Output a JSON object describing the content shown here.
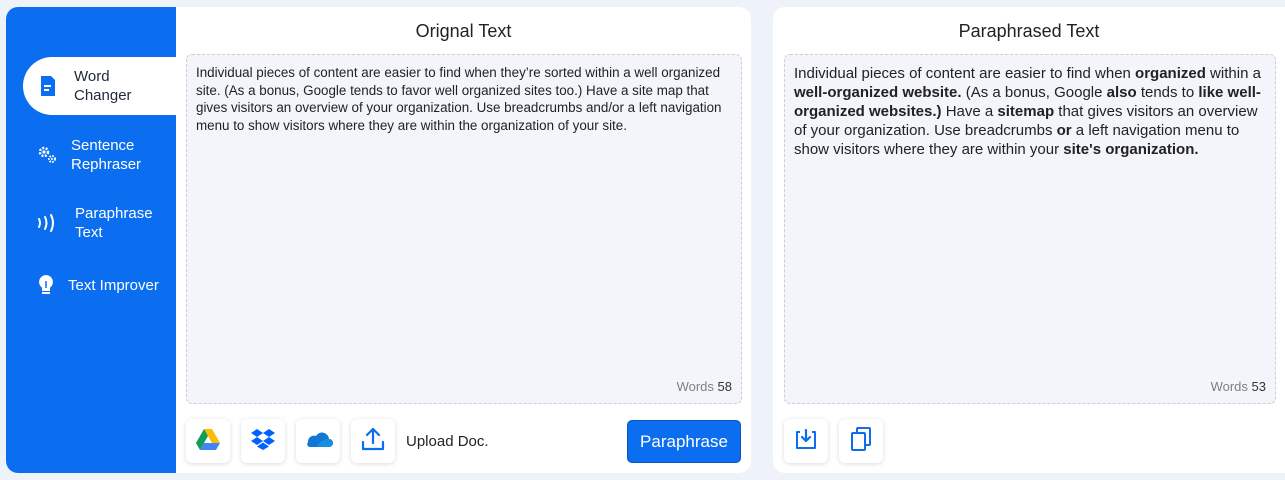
{
  "sidebar": {
    "items": [
      {
        "label": "Word\nChanger",
        "icon": "document-icon",
        "active": true
      },
      {
        "label": "Sentence\nRephraser",
        "icon": "gears-icon"
      },
      {
        "label": "Paraphrase\nText",
        "icon": "waves-icon"
      },
      {
        "label": "Text Improver",
        "icon": "lightbulb-icon"
      }
    ]
  },
  "original": {
    "title": "Orignal Text",
    "text": "Individual pieces of content are easier to find when they’re sorted within a well organized site. (As a bonus, Google tends to favor well organized sites too.) Have a site map that gives visitors an overview of your organization. Use breadcrumbs and/or a left navigation menu to show visitors where they are within the organization of your site.",
    "words_label": "Words",
    "words_count": "58"
  },
  "toolbar": {
    "buttons": [
      "google-drive-icon",
      "dropbox-icon",
      "onedrive-icon",
      "upload-icon"
    ],
    "upload_label": "Upload Doc.",
    "paraphrase_label": "Paraphrase"
  },
  "paraphrased": {
    "title": "Paraphrased Text",
    "segments": [
      {
        "t": "Individual pieces of content are easier to find when ",
        "b": false
      },
      {
        "t": "organized",
        "b": true
      },
      {
        "t": " within a ",
        "b": false
      },
      {
        "t": "well-organized website.",
        "b": true
      },
      {
        "t": " (As a bonus, Google ",
        "b": false
      },
      {
        "t": "also",
        "b": true
      },
      {
        "t": " tends to ",
        "b": false
      },
      {
        "t": "like well-organized websites.)",
        "b": true
      },
      {
        "t": " Have a ",
        "b": false
      },
      {
        "t": "sitemap",
        "b": true
      },
      {
        "t": " that gives visitors an overview of your organization. Use breadcrumbs ",
        "b": false
      },
      {
        "t": "or",
        "b": true
      },
      {
        "t": " a left navigation menu to show visitors where they are within your ",
        "b": false
      },
      {
        "t": "site's organization.",
        "b": true
      }
    ],
    "words_label": "Words",
    "words_count": "53",
    "actions": [
      "download-icon",
      "copy-icon"
    ]
  },
  "colors": {
    "accent": "#0b6ef0",
    "background": "#eef3fa",
    "textbox": "#f3f5fb"
  }
}
